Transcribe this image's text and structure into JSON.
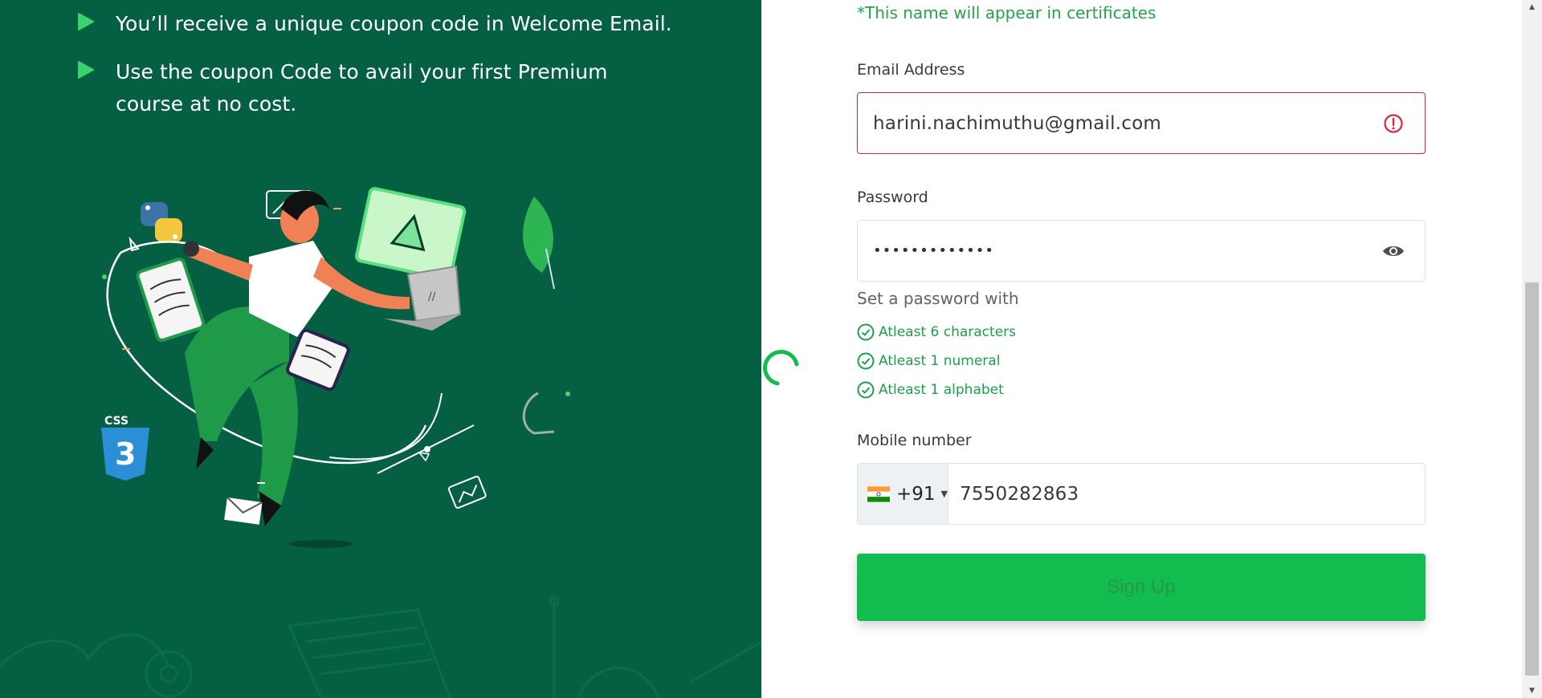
{
  "benefits": [
    {
      "text": "You’ll receive a unique coupon code in Welcome Email."
    },
    {
      "text": "Use the coupon Code to avail your first Premium course at no cost."
    }
  ],
  "form": {
    "name_hint": "*This name will appear in certificates",
    "email": {
      "label": "Email Address",
      "value": "harini.nachimuthu@gmail.com",
      "state": "error"
    },
    "password": {
      "label": "Password",
      "value": "•••••••••••••",
      "help_title": "Set a password with",
      "rules": [
        {
          "text": "Atleast 6 characters",
          "met": true
        },
        {
          "text": "Atleast 1 numeral",
          "met": true
        },
        {
          "text": "Atleast 1 alphabet",
          "met": true
        }
      ]
    },
    "mobile": {
      "label": "Mobile number",
      "country_code": "+91",
      "value": "7550282863"
    },
    "submit_label": "Sign Up"
  },
  "colors": {
    "panel_bg": "#055f42",
    "accent_green": "#12bc4e",
    "error_red": "#d7263d",
    "hint_green": "#25a348"
  },
  "icons": {
    "bullet": "play-triangle-icon",
    "email_error": "alert-circle-icon",
    "password_toggle": "eye-icon",
    "rule_check": "check-circle-icon",
    "loading": "spinner-icon",
    "country_flag": "india-flag-icon"
  }
}
